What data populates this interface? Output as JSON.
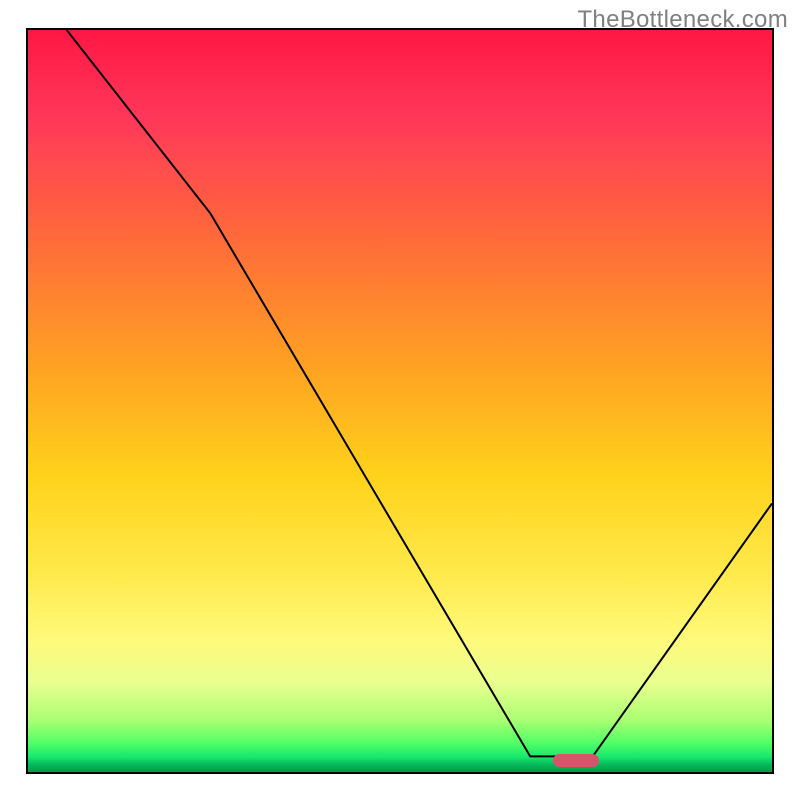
{
  "watermark": "TheBottleneck.com",
  "chart_data": {
    "type": "line",
    "title": "",
    "xlabel": "",
    "ylabel": "",
    "xlim": [
      0,
      100
    ],
    "ylim": [
      0,
      100
    ],
    "grid": false,
    "series": [
      {
        "name": "bottleneck-curve",
        "x": [
          5.2,
          24.5,
          67.5,
          75.9,
          100.0
        ],
        "y": [
          100.0,
          75.3,
          2.1,
          2.1,
          36.2
        ],
        "color": "#000000"
      }
    ],
    "annotations": [
      {
        "name": "optimal-range",
        "shape": "pill",
        "x_start": 70.5,
        "x_end": 76.8,
        "y": 1.6,
        "color": "#d9536b"
      }
    ],
    "background_gradient_bands": [
      {
        "y": 100,
        "color": "#ff1744"
      },
      {
        "y": 88,
        "color": "#ff385a"
      },
      {
        "y": 72,
        "color": "#ff6a3a"
      },
      {
        "y": 55,
        "color": "#ffa023"
      },
      {
        "y": 40,
        "color": "#ffd21a"
      },
      {
        "y": 27,
        "color": "#ffe94a"
      },
      {
        "y": 18,
        "color": "#fff97a"
      },
      {
        "y": 12,
        "color": "#e9ff8f"
      },
      {
        "y": 7,
        "color": "#aaff73"
      },
      {
        "y": 4,
        "color": "#54ff66"
      },
      {
        "y": 2,
        "color": "#16e86c"
      },
      {
        "y": 1,
        "color": "#07b85b"
      },
      {
        "y": 0,
        "color": "#009944"
      }
    ]
  }
}
